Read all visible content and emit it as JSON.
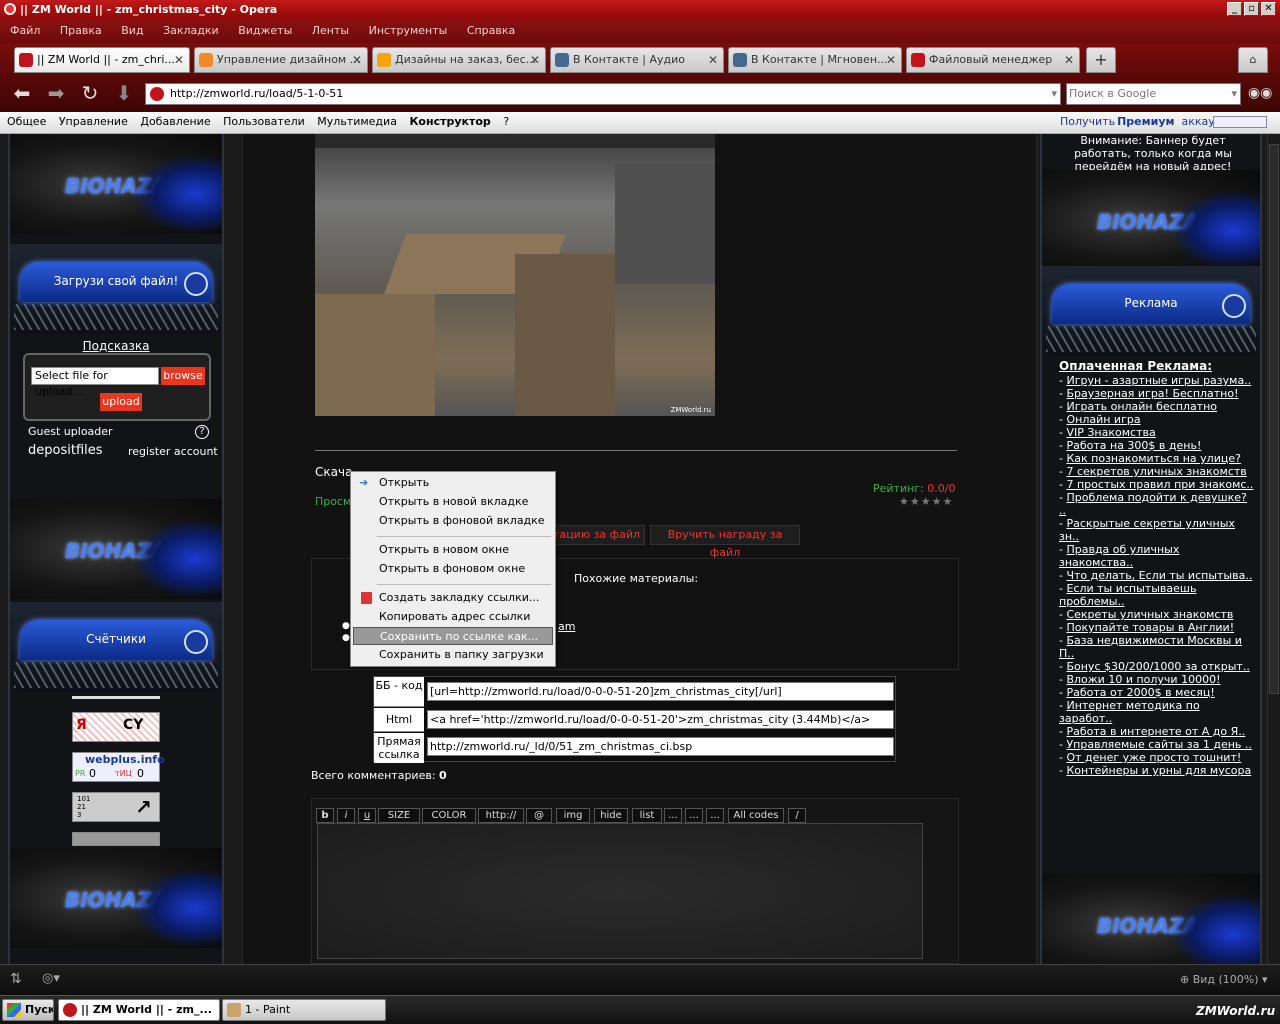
{
  "window": {
    "title": "|| ZM World || - zm_christmas_city - Opera"
  },
  "menu": [
    "Файл",
    "Правка",
    "Вид",
    "Закладки",
    "Виджеты",
    "Ленты",
    "Инструменты",
    "Справка"
  ],
  "tabs": [
    {
      "label": "|| ZM World || - zm_chri...",
      "color": "#c0141d"
    },
    {
      "label": "Управление дизайном ...",
      "color": "#f08a2b"
    },
    {
      "label": "Дизайны на заказ, бес...",
      "color": "#f5a400"
    },
    {
      "label": "В Контакте | Аудио",
      "color": "#45688e"
    },
    {
      "label": "В Контакте | Мгновен...",
      "color": "#45688e"
    },
    {
      "label": "Файловый менеджер",
      "color": "#c0141d"
    }
  ],
  "address": {
    "url": "http://zmworld.ru/load/5-1-0-51",
    "search_placeholder": "Поиск в Google"
  },
  "bookmarks": [
    "Общее",
    "Управление",
    "Добавление",
    "Пользователи",
    "Мультимедиа",
    "Конструктор",
    "?"
  ],
  "premium": {
    "pre": "Получить ",
    "bold": "Премиум",
    "post": " аккаунт"
  },
  "left": {
    "banner_logo": "BIOHAZARD",
    "upload_box_title": "Загрузи свой файл!",
    "hint_link": "Подсказка",
    "file_placeholder": "Select file for upload...",
    "browse": "browse",
    "upload": "upload",
    "guest_uploader": "Guest uploader",
    "help": "?",
    "depositfiles": "depositfiles",
    "register": "register account",
    "counters_title": "Счётчики",
    "webplus": "webplus.info",
    "pr_label": "PR",
    "pr_value": "0",
    "tic_label": "тИЦ",
    "tic_value": "0",
    "ya_cy": "CY",
    "counter_digits": "101\n21\n3"
  },
  "main": {
    "screenshot_watermark": "ZMWorld.ru",
    "download_label": "Скача",
    "rating_label": "Рейтинг: ",
    "rating_value": "0.0/0",
    "views_label": "Просм",
    "btn_reputation": "утацию за файл",
    "btn_award": "Вручить награду за файл",
    "similar_title": "Похожие материалы:",
    "similar_link_tail": "am",
    "bb_label": "ББ - код",
    "bb_value": "[url=http://zmworld.ru/load/0-0-0-51-20]zm_christmas_city[/url]",
    "html_label": "Html",
    "html_value": "<a href='http://zmworld.ru/load/0-0-0-51-20'>zm_christmas_city (3.44Mb)</a>",
    "direct_label": "Прямая ссылка",
    "direct_value": "http://zmworld.ru/_ld/0/51_zm_christmas_ci.bsp",
    "comments_label": "Всего комментариев: ",
    "comments_count": "0",
    "bbcodes": [
      "b",
      "i",
      "u",
      "SIZE",
      "COLOR",
      "http://",
      "@",
      "img",
      "hide",
      "list",
      "...",
      "...",
      "...",
      "All codes",
      "/"
    ]
  },
  "context_menu": [
    "Открыть",
    "Открыть в новой вкладке",
    "Открыть в фоновой вкладке",
    "Открыть в новом окне",
    "Открыть в фоновом окне",
    "Создать закладку ссылки...",
    "Копировать адрес ссылки",
    "Сохранить по ссылке как...",
    "Сохранить в папку загрузки"
  ],
  "right": {
    "top_text": "Внимание: Баннер будет работать, только когда мы перейдём на новый адрес!",
    "ads_title": "Реклама",
    "paid_title": "Оплаченная Реклама:",
    "ads": [
      "Игрун - азартные игры разума..",
      "Браузерная игра! Бесплатно!",
      "Играть онлайн бесплатно",
      "Онлайн игра",
      "VIP Знакомства",
      "Работа на 300$ в день!",
      "Как познакомиться на улице?",
      "7 секретов уличных знакомств",
      "7 простых правил при знакомс..",
      "Проблема подойти к девушке? ..",
      "Раскрытые секреты уличных зн..",
      "Правда об уличных знакомства..",
      "Что делать, Если ты испытыва..",
      "Если ты испытываешь проблемы..",
      "Секреты уличных знакомств",
      "Покупайте товары в Англии!",
      "База недвижимости Москвы и П..",
      "Бонус $30/200/1000 за открыт..",
      "Вложи 10 и получи 10000!",
      "Работа от 2000$ в месяц!",
      "Интернет методика по заработ..",
      "Работа в интернете от А до Я..",
      "Управляемые сайты за 1 день ..",
      "От денег уже просто тошнит!",
      "Контейнеры и урны для мусора"
    ]
  },
  "status": {
    "zoom": "Вид (100%)"
  },
  "taskbar": {
    "start": "Пуск",
    "items": [
      "|| ZM World || - zm_...",
      "1 - Paint"
    ],
    "watermark": "ZMWorld.ru"
  }
}
